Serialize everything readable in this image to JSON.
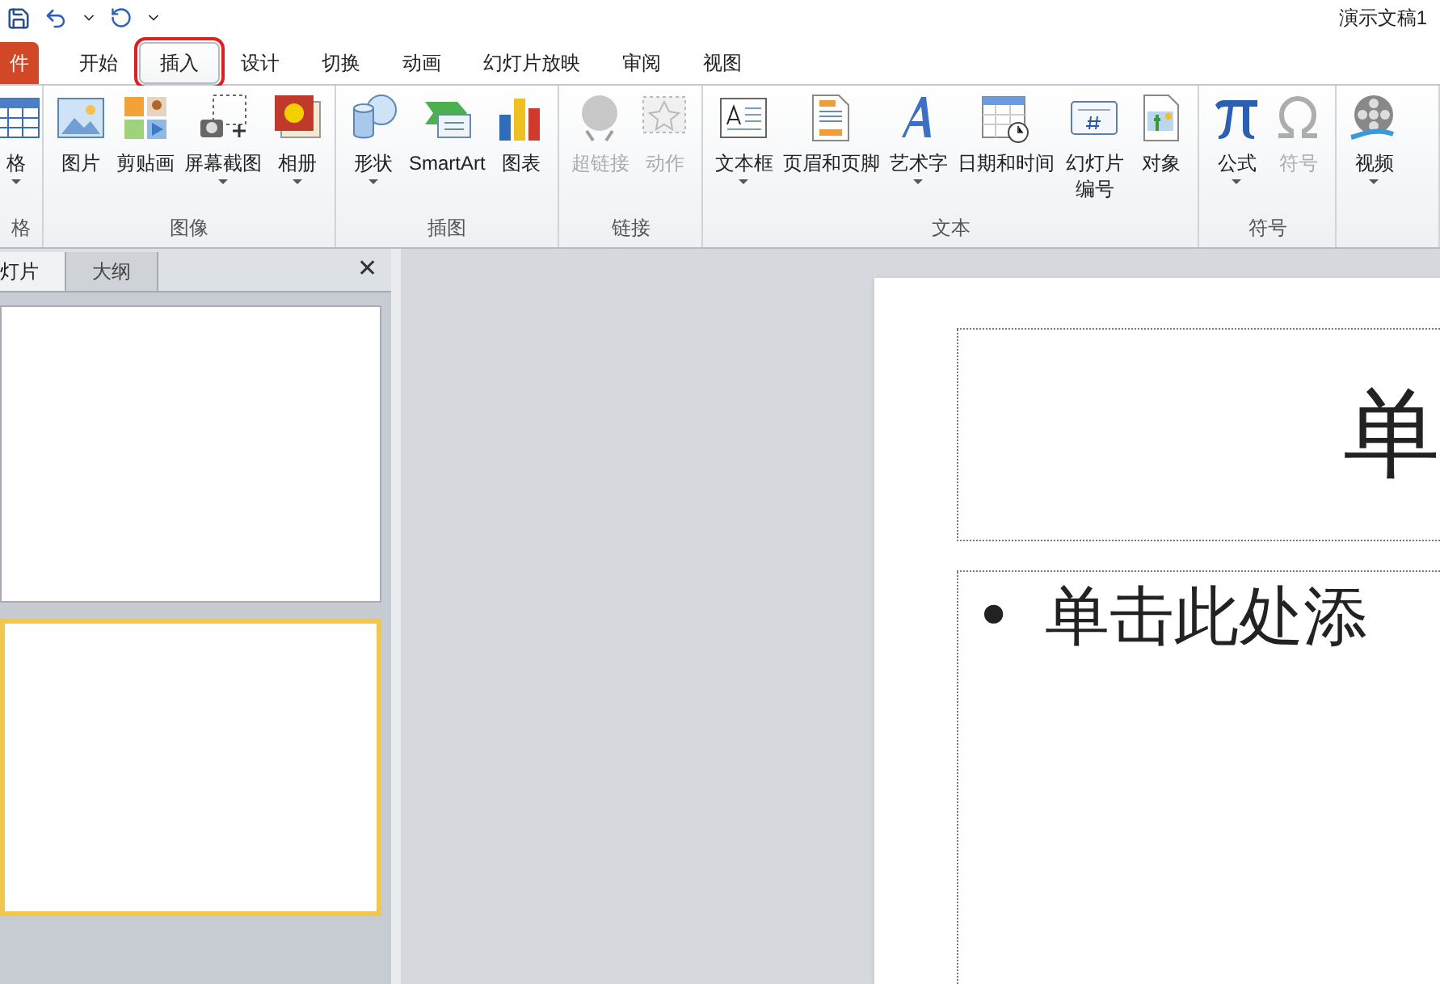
{
  "window": {
    "title": "演示文稿1"
  },
  "tabs": [
    {
      "label": "件",
      "kind": "file",
      "selected": false,
      "highlighted": false
    },
    {
      "label": "开始",
      "kind": "tab",
      "selected": false,
      "highlighted": false
    },
    {
      "label": "插入",
      "kind": "tab",
      "selected": true,
      "highlighted": true
    },
    {
      "label": "设计",
      "kind": "tab",
      "selected": false,
      "highlighted": false
    },
    {
      "label": "切换",
      "kind": "tab",
      "selected": false,
      "highlighted": false
    },
    {
      "label": "动画",
      "kind": "tab",
      "selected": false,
      "highlighted": false
    },
    {
      "label": "幻灯片放映",
      "kind": "tab",
      "selected": false,
      "highlighted": false
    },
    {
      "label": "审阅",
      "kind": "tab",
      "selected": false,
      "highlighted": false
    },
    {
      "label": "视图",
      "kind": "tab",
      "selected": false,
      "highlighted": false
    }
  ],
  "ribbon": {
    "groups": [
      {
        "label": "格",
        "buttons": [
          {
            "label": "格",
            "dropdown": true,
            "disabled": false
          }
        ]
      },
      {
        "label": "图像",
        "buttons": [
          {
            "label": "图片",
            "dropdown": false,
            "disabled": false
          },
          {
            "label": "剪贴画",
            "dropdown": false,
            "disabled": false
          },
          {
            "label": "屏幕截图",
            "dropdown": true,
            "disabled": false
          },
          {
            "label": "相册",
            "dropdown": true,
            "disabled": false
          }
        ]
      },
      {
        "label": "插图",
        "buttons": [
          {
            "label": "形状",
            "dropdown": true,
            "disabled": false
          },
          {
            "label": "SmartArt",
            "dropdown": false,
            "disabled": false
          },
          {
            "label": "图表",
            "dropdown": false,
            "disabled": false
          }
        ]
      },
      {
        "label": "链接",
        "buttons": [
          {
            "label": "超链接",
            "dropdown": false,
            "disabled": true
          },
          {
            "label": "动作",
            "dropdown": false,
            "disabled": true
          }
        ]
      },
      {
        "label": "文本",
        "buttons": [
          {
            "label": "文本框",
            "dropdown": true,
            "disabled": false
          },
          {
            "label": "页眉和页脚",
            "dropdown": false,
            "disabled": false
          },
          {
            "label": "艺术字",
            "dropdown": true,
            "disabled": false
          },
          {
            "label": "日期和时间",
            "dropdown": false,
            "disabled": false
          },
          {
            "label": "幻灯片编号",
            "dropdown": false,
            "disabled": false
          },
          {
            "label": "对象",
            "dropdown": false,
            "disabled": false
          }
        ]
      },
      {
        "label": "符号",
        "buttons": [
          {
            "label": "公式",
            "dropdown": true,
            "disabled": false
          },
          {
            "label": "符号",
            "dropdown": false,
            "disabled": true
          }
        ]
      },
      {
        "buttons": [
          {
            "label": "视频",
            "dropdown": true,
            "disabled": false
          }
        ]
      }
    ]
  },
  "panel": {
    "tabs": [
      {
        "label": "灯片",
        "selected": true
      },
      {
        "label": "大纲",
        "selected": false
      }
    ],
    "close": "✕",
    "slides": [
      {
        "selected": false
      },
      {
        "selected": true
      }
    ]
  },
  "slide": {
    "title": "单",
    "bullet": "•",
    "body": "单击此处添"
  }
}
